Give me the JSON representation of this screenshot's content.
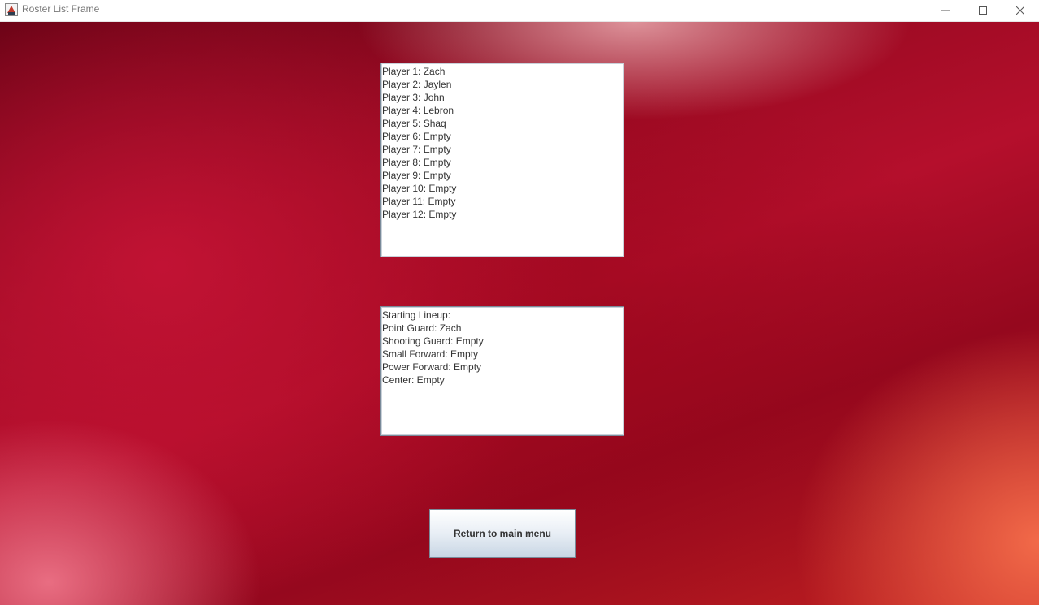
{
  "window": {
    "title": "Roster List Frame"
  },
  "roster": {
    "lines": [
      "Player 1: Zach",
      "Player 2: Jaylen",
      "Player 3: John",
      "Player 4: Lebron",
      "Player 5: Shaq",
      "Player 6: Empty",
      "Player 7: Empty",
      "Player 8: Empty",
      "Player 9: Empty",
      "Player 10: Empty",
      "Player 11: Empty",
      "Player 12: Empty"
    ]
  },
  "lineup": {
    "lines": [
      "Starting Lineup:",
      "Point Guard: Zach",
      "Shooting Guard: Empty",
      "Small Forward: Empty",
      "Power Forward: Empty",
      "Center: Empty"
    ]
  },
  "actions": {
    "return_label": "Return to main menu"
  },
  "icons": {
    "app": "java-app-icon",
    "minimize": "minimize-icon",
    "maximize": "maximize-icon",
    "close": "close-icon"
  },
  "colors": {
    "background_primary": "#b50f2c",
    "background_highlight": "#f56e4b",
    "button_gradient_top": "#ffffff",
    "button_gradient_bottom": "#c8d6e4"
  }
}
